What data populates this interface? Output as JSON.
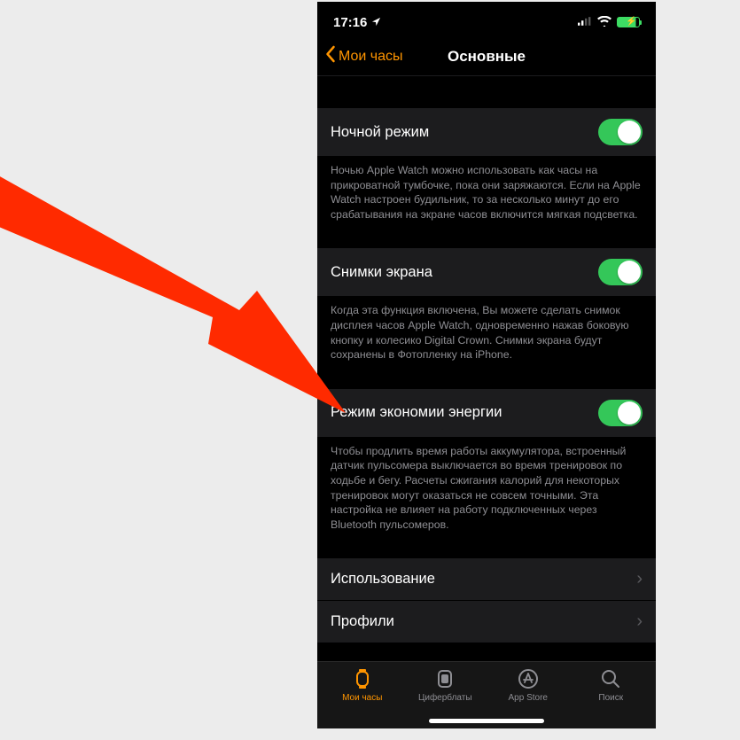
{
  "status": {
    "time": "17:16"
  },
  "nav": {
    "back": "Мои часы",
    "title": "Основные"
  },
  "settings": {
    "night_mode": {
      "label": "Ночной режим",
      "desc": "Ночью Apple Watch можно использовать как часы на прикроватной тумбочке, пока они заряжаются. Если на Apple Watch настроен будильник, то за несколько минут до его срабатывания на экране часов включится мягкая подсветка."
    },
    "screenshots": {
      "label": "Снимки экрана",
      "desc": "Когда эта функция включена, Вы можете сделать снимок дисплея часов Apple Watch, одновременно нажав боковую кнопку и колесико Digital Crown. Снимки экрана будут сохранены в Фотопленку на iPhone."
    },
    "power_save": {
      "label": "Режим экономии энергии",
      "desc": "Чтобы продлить время работы аккумулятора, встроенный датчик пульсомера выключается во время тренировок по ходьбе и бегу. Расчеты сжигания калорий для некоторых тренировок могут оказаться не совсем точными. Эта настройка не влияет на работу подключенных через Bluetooth пульсомеров."
    },
    "usage": {
      "label": "Использование"
    },
    "profiles": {
      "label": "Профили"
    }
  },
  "tabs": {
    "watch": "Мои часы",
    "faces": "Циферблаты",
    "store": "App Store",
    "search": "Поиск"
  }
}
